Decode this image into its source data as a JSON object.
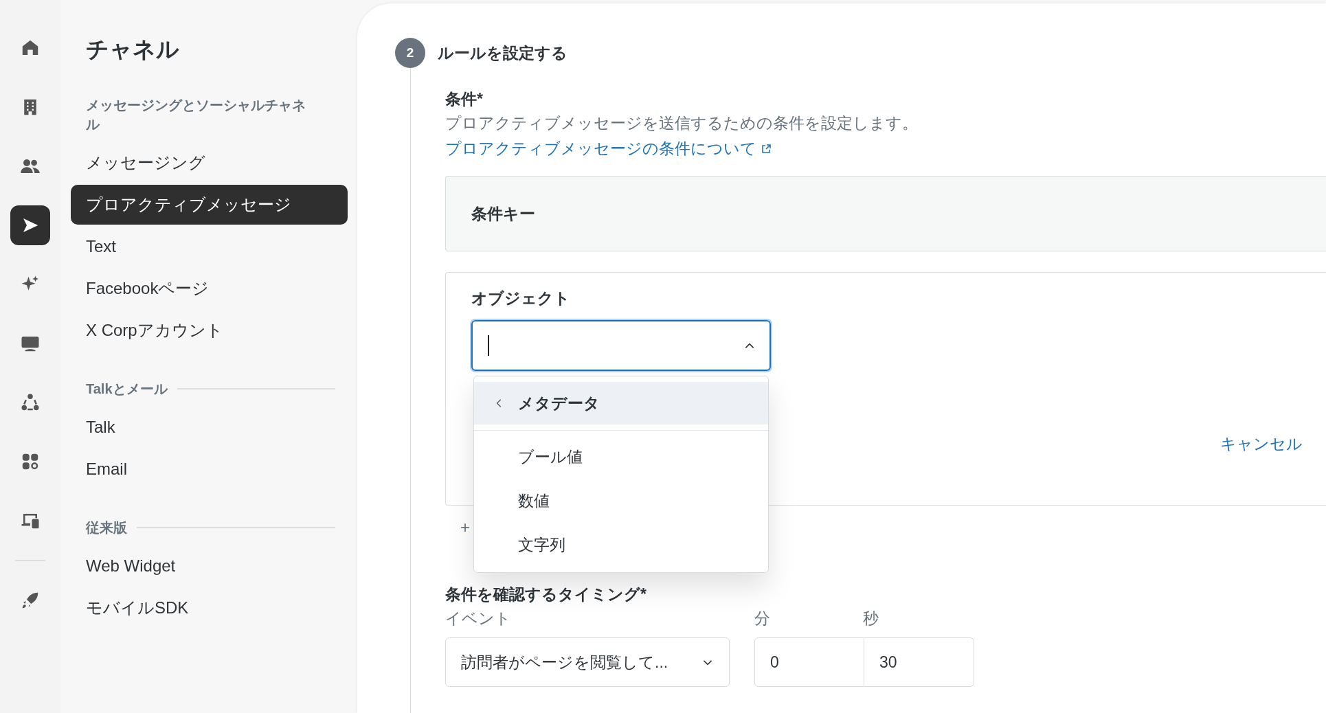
{
  "rail": {
    "items": [
      {
        "selected": false
      },
      {
        "selected": false
      },
      {
        "selected": false
      },
      {
        "selected": true
      },
      {
        "selected": false
      },
      {
        "selected": false
      },
      {
        "selected": false
      },
      {
        "selected": false
      },
      {
        "selected": false
      }
    ],
    "footer_items": [
      {
        "selected": false
      }
    ]
  },
  "sidebar": {
    "title": "チャネル",
    "sections": [
      {
        "heading": "メッセージングとソーシャルチャネル",
        "kind": "plain",
        "items": [
          {
            "label": "メッセージング",
            "selected": false
          },
          {
            "label": "プロアクティブメッセージ",
            "selected": true
          },
          {
            "label": "Text",
            "selected": false
          },
          {
            "label": "Facebookページ",
            "selected": false
          },
          {
            "label": "X Corpアカウント",
            "selected": false
          }
        ]
      },
      {
        "heading": "Talkとメール",
        "kind": "ruled",
        "items": [
          {
            "label": "Talk",
            "selected": false
          },
          {
            "label": "Email",
            "selected": false
          }
        ]
      },
      {
        "heading": "従来版",
        "kind": "ruled",
        "items": [
          {
            "label": "Web Widget",
            "selected": false
          },
          {
            "label": "モバイルSDK",
            "selected": false
          }
        ]
      }
    ]
  },
  "step": {
    "number": "2",
    "title": "ルールを設定する"
  },
  "condition": {
    "label": "条件*",
    "description": "プロアクティブメッセージを送信するための条件を設定します。",
    "link": "プロアクティブメッセージの条件について"
  },
  "condition_key": {
    "label": "条件キー"
  },
  "object": {
    "label": "オブジェクト",
    "combobox": {
      "expanded": true
    },
    "dropdown": {
      "back_label": "メタデータ",
      "options": [
        {
          "label": "ブール値"
        },
        {
          "label": "数値"
        },
        {
          "label": "文字列"
        }
      ]
    },
    "cancel": "キャンセル",
    "add": "+"
  },
  "timing": {
    "label": "条件を確認するタイミング*",
    "event_label": "イベント",
    "minutes_label": "分",
    "seconds_label": "秒",
    "event_value": "訪問者がページを閲覧して...",
    "minutes_value": "0",
    "seconds_value": "30"
  }
}
